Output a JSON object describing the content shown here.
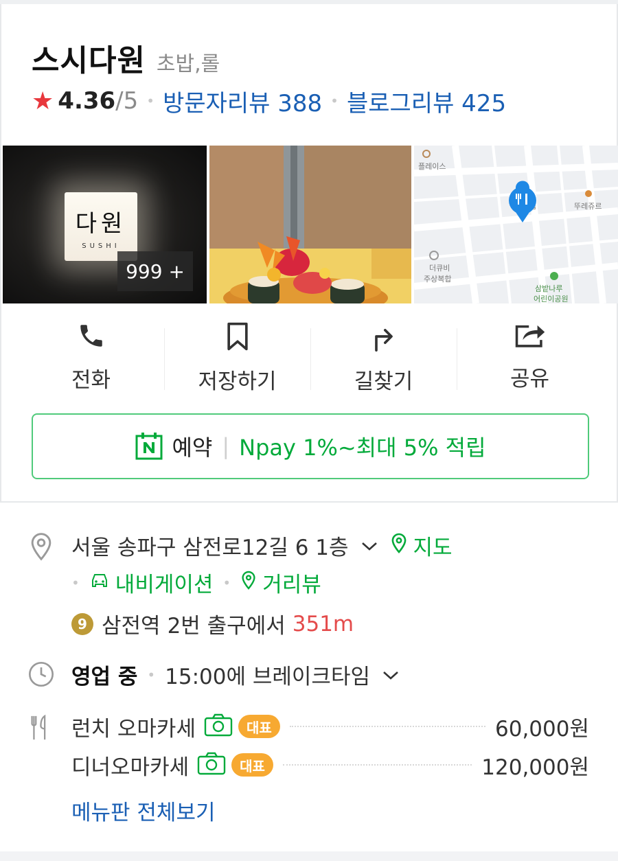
{
  "place": {
    "name": "스시다원",
    "category": "초밥,롤"
  },
  "rating": {
    "star_icon": "star-icon",
    "score": "4.36",
    "max": "/5",
    "visitor_reviews": "방문자리뷰 388",
    "blog_reviews": "블로그리뷰 425"
  },
  "photos": {
    "sign_text": "다원",
    "sign_sub": "SUSHI",
    "count": "999 +",
    "map_labels": {
      "place": "플레이스",
      "shop_right": "뚜레쥬르",
      "shop_mid": "집",
      "building1": "더큐비",
      "building2": "주상복합",
      "park1": "삼밭나루",
      "park2": "어린이공원"
    }
  },
  "actions": [
    {
      "label": "전화",
      "icon": "phone-icon"
    },
    {
      "label": "저장하기",
      "icon": "bookmark-icon"
    },
    {
      "label": "길찾기",
      "icon": "directions-icon"
    },
    {
      "label": "공유",
      "icon": "share-icon"
    }
  ],
  "reserve": {
    "icon": "naver-calendar-icon",
    "label": "예약",
    "promo": "Npay 1%~최대 5% 적립"
  },
  "info": {
    "address": "서울 송파구 삼전로12길 6 1층",
    "map_link": "지도",
    "navigation_link": "내비게이션",
    "street_view_link": "거리뷰",
    "subway_line": "9",
    "subway_station": "삼전역",
    "subway_exit": "2번 출구에서",
    "subway_distance": "351m",
    "hours_status": "영업 중",
    "hours_detail": "15:00에 브레이크타임",
    "menu": [
      {
        "name": "런치 오마카세",
        "badge": "대표",
        "price": "60,000원"
      },
      {
        "name": "디너오마카세",
        "badge": "대표",
        "price": "120,000원"
      }
    ],
    "menu_all_link": "메뉴판 전체보기"
  },
  "colors": {
    "accent_blue": "#1a5fb4",
    "naver_green": "#03aa3a",
    "star_red": "#e8383d",
    "badge_orange": "#f7a931",
    "line9_gold": "#bd9a37"
  }
}
